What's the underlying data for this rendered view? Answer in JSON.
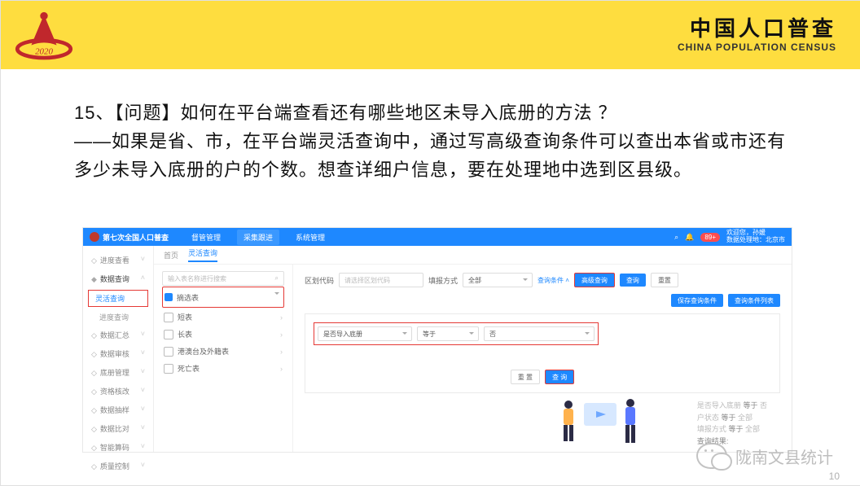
{
  "brand": {
    "cn": "中国人口普查",
    "en": "CHINA POPULATION CENSUS",
    "year": "2020"
  },
  "question": {
    "line1": "15、【问题】如何在平台端查看还有哪些地区未导入底册的方法 ？",
    "line2": "——如果是省、市，在平台端灵活查询中，通过写高级查询条件可以查出本省或市还有多少未导入底册的户的个数。想查详细户信息，要在处理地中选到区县级。"
  },
  "app": {
    "title": "第七次全国人口普查",
    "nav": {
      "t1": "督管管理",
      "t2": "采集跟进",
      "t3": "系统管理"
    },
    "badge": "89+",
    "user_line1": "欢迎您，孙媛",
    "user_line2": "数据处理地：北京市"
  },
  "sidebar": {
    "s1": "进度查看",
    "s2": "数据查询",
    "s2a": "灵活查询",
    "s2b": "进度查询",
    "s3": "数据汇总",
    "s4": "数据审核",
    "s5": "底册管理",
    "s6": "资格核改",
    "s7": "数据抽样",
    "s8": "数据比对",
    "s9": "智能算码",
    "s10": "质量控制"
  },
  "crumbs": {
    "a": "首页",
    "b": "灵活查询"
  },
  "listcol": {
    "search_ph": "输入表名称进行搜索",
    "i1": "摘选表",
    "i2": "短表",
    "i3": "长表",
    "i4": "港澳台及外籍表",
    "i5": "死亡表"
  },
  "form": {
    "f_code": "区划代码",
    "f_code_ph": "请选择区划代码",
    "f_fill": "填报方式",
    "f_fill_v": "全部",
    "link_cond": "查询条件",
    "btn_adv": "高级查询",
    "btn_qry": "查询",
    "btn_rst": "重置",
    "btn_save": "保存查询条件",
    "btn_list": "查询条件列表",
    "cond_field": "是否导入底册",
    "cond_op": "等于",
    "cond_val": "否",
    "btn_reset2": "重 置",
    "btn_query2": "查 询"
  },
  "result": {
    "r1a": "是否导入底册",
    "r1b": "等于",
    "r1c": "否",
    "r2a": "户状态",
    "r2b": "等于",
    "r2c": "全部",
    "r3a": "填报方式",
    "r3b": "等于",
    "r3c": "全部",
    "r4": "查询结果:"
  },
  "watermark": "陇南文县统计",
  "page": "10"
}
